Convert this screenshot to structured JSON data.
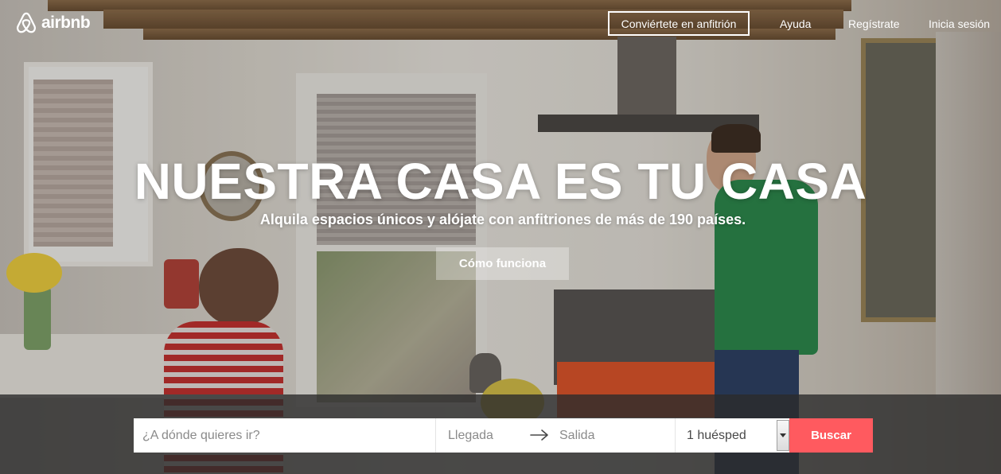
{
  "header": {
    "logo_text": "airbnb",
    "host_button": "Conviértete en anfitrión",
    "nav": {
      "help": "Ayuda",
      "signup": "Regístrate",
      "login": "Inicia sesión"
    }
  },
  "hero": {
    "title": "NUESTRA CASA ES TU CASA",
    "subtitle": "Alquila espacios únicos y alójate con anfitriones de más de 190 países.",
    "how_button": "Cómo funciona"
  },
  "search": {
    "where_placeholder": "¿A dónde quieres ir?",
    "checkin_placeholder": "Llegada",
    "checkout_placeholder": "Salida",
    "guests_value": "1 huésped",
    "submit": "Buscar"
  },
  "colors": {
    "brand": "#ff5a5f",
    "header_text": "#ffffff"
  },
  "icons": {
    "logo": "airbnb-belo-icon",
    "date_arrow": "arrow-right-icon",
    "guests_dropdown": "caret-down-icon"
  }
}
